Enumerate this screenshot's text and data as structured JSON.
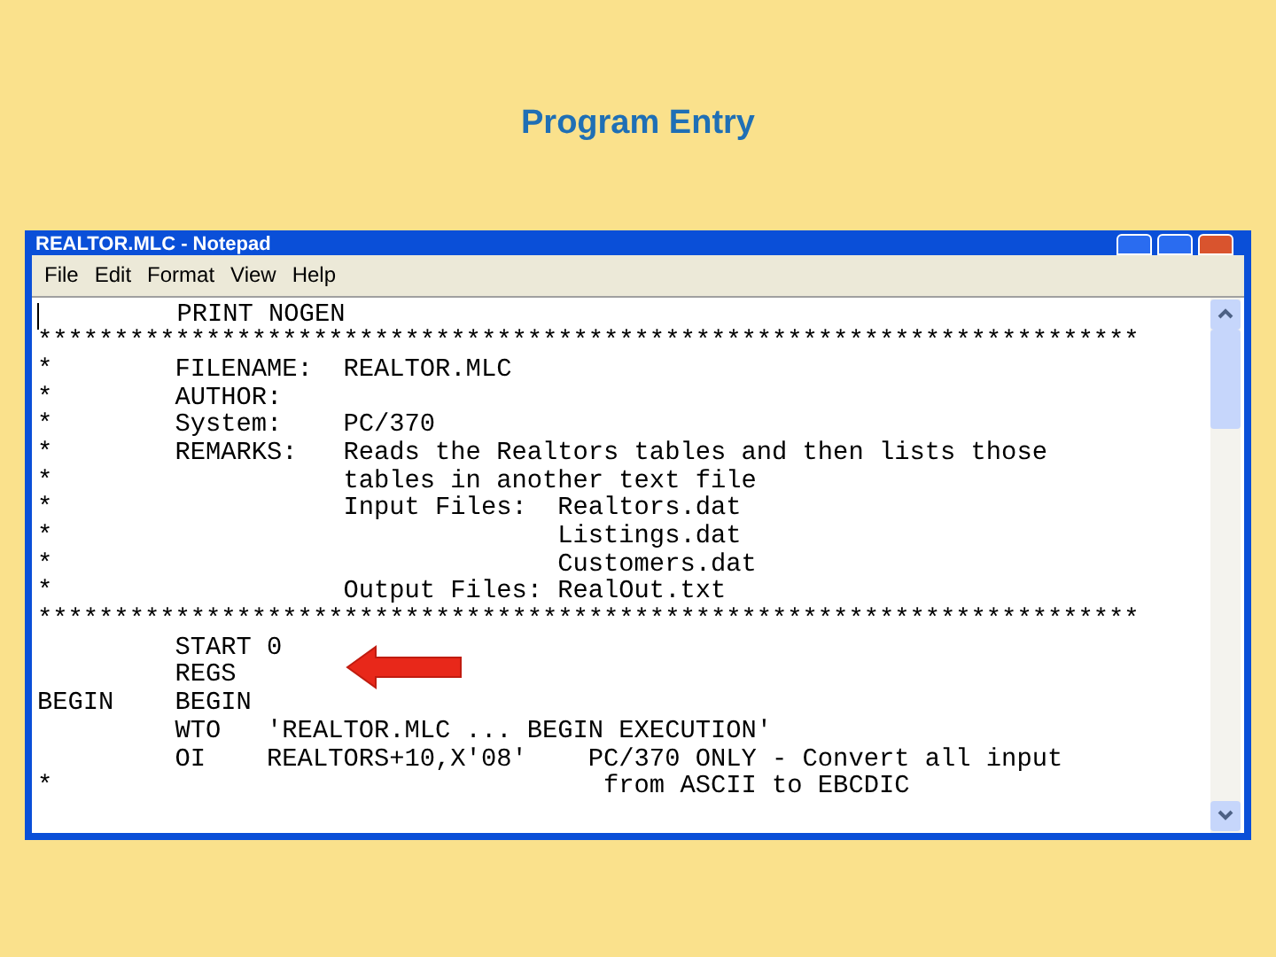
{
  "slide_title": "Program Entry",
  "window": {
    "title": "REALTOR.MLC - Notepad",
    "menu": [
      "File",
      "Edit",
      "Format",
      "View",
      "Help"
    ],
    "lines": [
      "         PRINT NOGEN",
      "************************************************************************",
      "*        FILENAME:  REALTOR.MLC",
      "*        AUTHOR:",
      "*        System:    PC/370",
      "*        REMARKS:   Reads the Realtors tables and then lists those",
      "*                   tables in another text file",
      "*                   Input Files:  Realtors.dat",
      "*                                 Listings.dat",
      "*                                 Customers.dat",
      "*                   Output Files: RealOut.txt",
      "************************************************************************",
      "         START 0",
      "         REGS",
      "BEGIN    BEGIN",
      "         WTO   'REALTOR.MLC ... BEGIN EXECUTION'",
      "         OI    REALTORS+10,X'08'    PC/370 ONLY - Convert all input",
      "*                                    from ASCII to EBCDIC"
    ]
  }
}
